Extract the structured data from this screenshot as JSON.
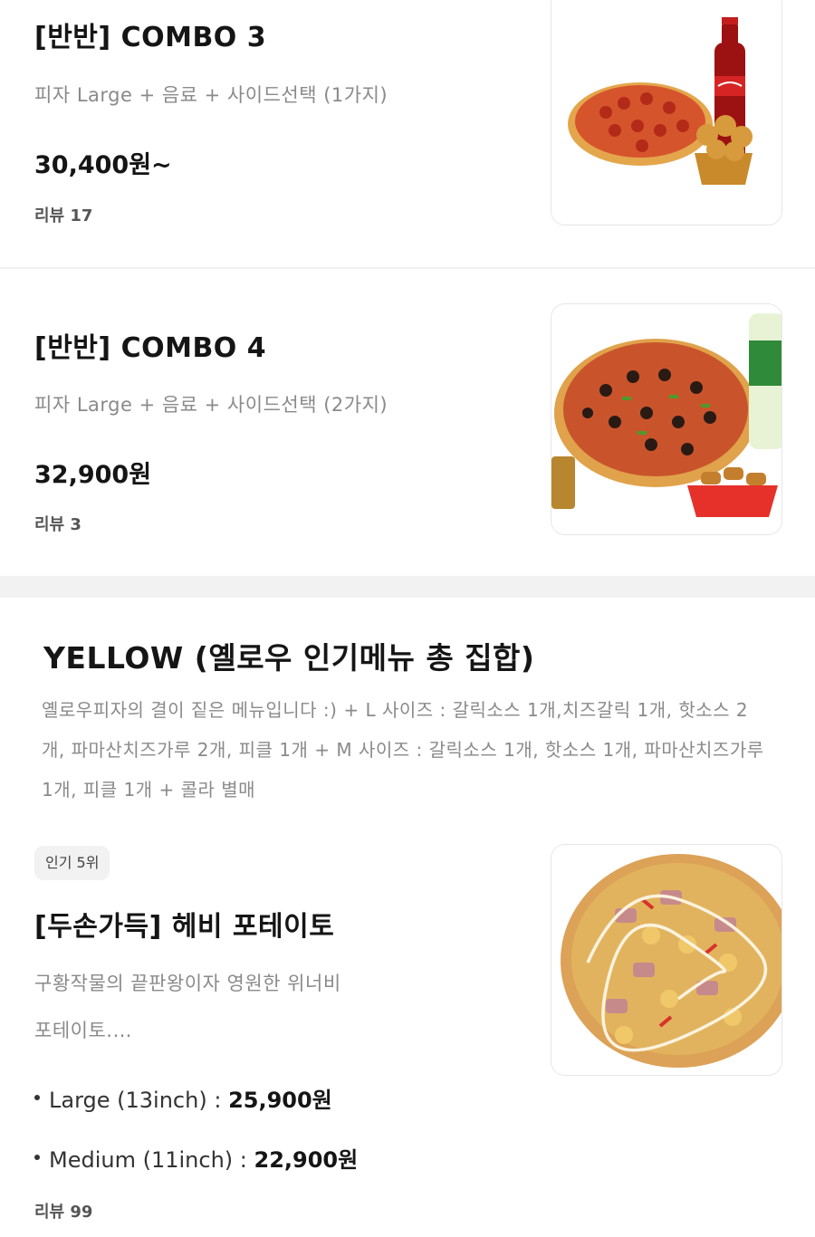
{
  "items": [
    {
      "name": "[반반] COMBO 3",
      "desc": "피자 Large + 음료 + 사이드선택 (1가지)",
      "price": "30,400원~",
      "reviews": "리뷰 17",
      "image_icon": "pizza-combo-cola-image"
    },
    {
      "name": "[반반] COMBO 4",
      "desc": "피자 Large + 음료 + 사이드선택 (2가지)",
      "price": "32,900원",
      "reviews": "리뷰 3",
      "image_icon": "pizza-combo-sprite-image"
    }
  ],
  "section": {
    "title": "YELLOW (옐로우 인기메뉴 총 집합)",
    "desc": "옐로우피자의 결이 짙은 메뉴입니다 :) + L 사이즈 : 갈릭소스 1개,치즈갈릭 1개, 핫소스 2개, 파마산치즈가루 2개, 피클 1개 + M 사이즈 : 갈릭소스 1개, 핫소스 1개, 파마산치즈가루 1개, 피클 1개 + 콜라 별매"
  },
  "featured": {
    "badge": "인기 5위",
    "name": "[두손가득] 헤비 포테이토",
    "desc_line1": "구황작물의 끝판왕이자 영원한 위너비",
    "desc_line2": "포테이토.…",
    "options": [
      {
        "label": "Large (13inch) :",
        "price": "25,900원"
      },
      {
        "label": "Medium (11inch) :",
        "price": "22,900원"
      }
    ],
    "reviews": "리뷰 99",
    "image_icon": "heavy-potato-pizza-image"
  },
  "colors": {
    "background": "#ffffff",
    "divider": "#f2f2f2",
    "text_primary": "#151515",
    "text_secondary": "#8a8a8a"
  }
}
